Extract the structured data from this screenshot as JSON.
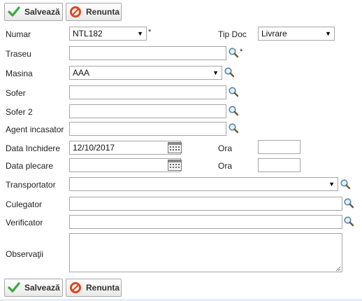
{
  "buttons": {
    "save_label": "Salvează",
    "cancel_label": "Renunta"
  },
  "form": {
    "numar": {
      "label": "Numar",
      "value": "NTL182",
      "required_mark": "*"
    },
    "tip_doc": {
      "label": "Tip Doc",
      "value": "Livrare"
    },
    "traseu": {
      "label": "Traseu",
      "value": "",
      "required_mark": "*"
    },
    "masina": {
      "label": "Masina",
      "value": "AAA"
    },
    "sofer": {
      "label": "Sofer",
      "value": ""
    },
    "sofer2": {
      "label": "Sofer 2",
      "value": ""
    },
    "agent": {
      "label": "Agent incasator",
      "value": ""
    },
    "data_inchidere": {
      "label": "Data Inchidere",
      "value": "12/10/2017"
    },
    "ora_inchidere": {
      "label": "Ora",
      "value": ""
    },
    "data_plecare": {
      "label": "Data plecare",
      "value": ""
    },
    "ora_plecare": {
      "label": "Ora",
      "value": ""
    },
    "transportator": {
      "label": "Transportator",
      "value": ""
    },
    "culegator": {
      "label": "Culegator",
      "value": ""
    },
    "verificator": {
      "label": "Verificator",
      "value": ""
    },
    "observatii": {
      "label": "Observaţii",
      "value": ""
    }
  },
  "colors": {
    "save_check": "#3aa93a",
    "cancel_circle": "#e0451f",
    "input_border": "#a6a6a6",
    "bottom_strip": "#e6eef6"
  },
  "icons": [
    "check-icon",
    "cancel-icon",
    "magnifier-icon",
    "calendar-icon",
    "chevron-down-icon"
  ]
}
